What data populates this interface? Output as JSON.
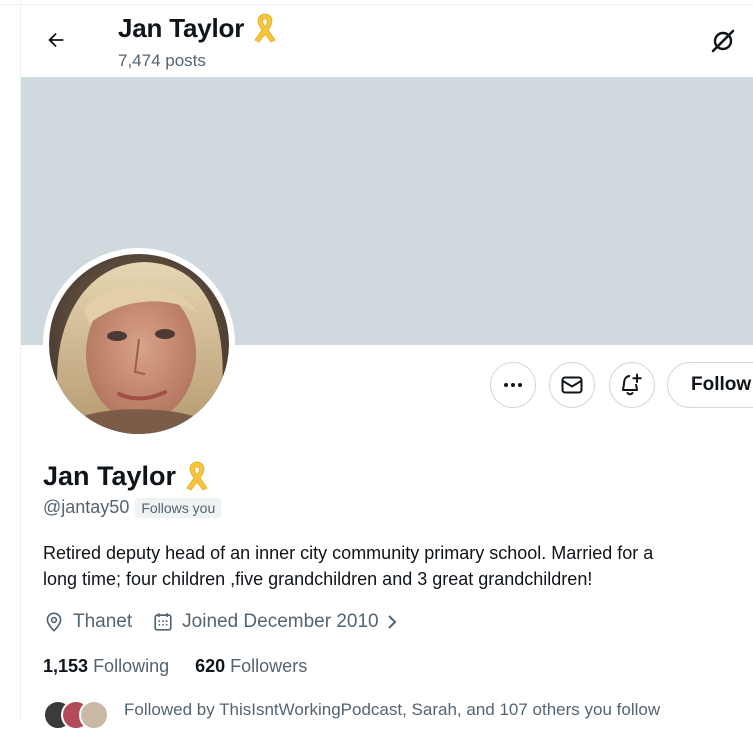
{
  "header": {
    "title": "Jan Taylor",
    "posts": "7,474 posts"
  },
  "profile": {
    "name": "Jan Taylor",
    "handle": "@jantay50",
    "follows_you": "Follows you",
    "bio_line1": "Retired deputy head of an inner city community primary school. Married for a",
    "bio_line2": "long time; four children ,five grandchildren and 3 great grandchildren!",
    "location": "Thanet",
    "joined": "Joined December 2010"
  },
  "stats": {
    "following_count": "1,153",
    "following_label": "Following",
    "followers_count": "620",
    "followers_label": "Followers"
  },
  "followed_by": "Followed by ThisIsntWorkingPodcast, Sarah, and 107 others you follow",
  "actions": {
    "follow_label": "Follow"
  },
  "colors": {
    "banner": "#cfd9de",
    "secondary_text": "#536471",
    "ribbon": "#f9c63b"
  },
  "icons": [
    "back-arrow-icon",
    "ribbon-icon",
    "grok-icon",
    "more-icon",
    "mail-icon",
    "bell-plus-icon",
    "location-icon",
    "calendar-icon",
    "chevron-right-icon"
  ]
}
